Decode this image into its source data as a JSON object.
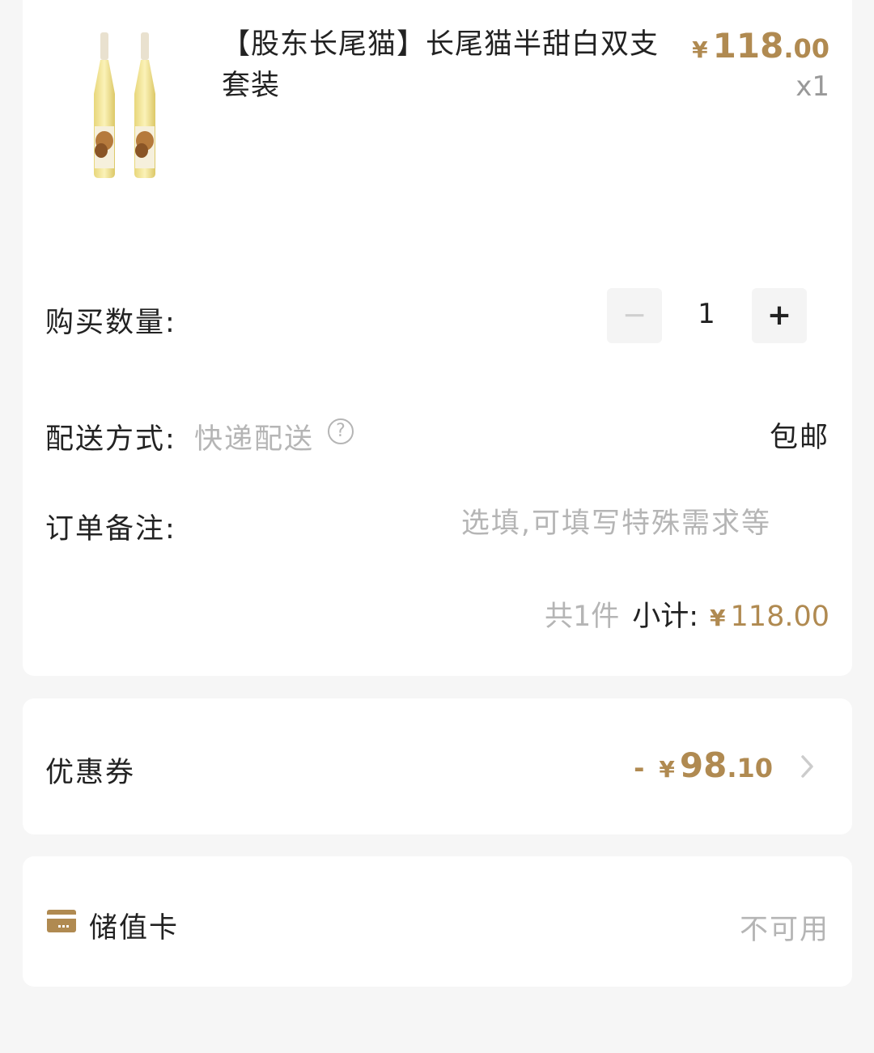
{
  "product": {
    "title": "【股东长尾猫】长尾猫半甜白双支套装",
    "price_symbol": "¥",
    "price_int": "118",
    "price_dec": ".00",
    "quantity_text": "x1"
  },
  "quantity": {
    "label": "购买数量:",
    "minus_label": "−",
    "value": "1",
    "plus_label": "+"
  },
  "shipping": {
    "label": "配送方式:",
    "method": "快递配送",
    "help_glyph": "?",
    "fee": "包邮"
  },
  "remark": {
    "label": "订单备注:",
    "placeholder": "选填,可填写特殊需求等",
    "value": ""
  },
  "subtotal": {
    "count_text": "共1件",
    "label": "小计:",
    "symbol": "¥",
    "amount": "118.00"
  },
  "coupon": {
    "label": "优惠券",
    "minus": "-",
    "symbol": "¥",
    "amount_int": "98",
    "amount_dec": ".10"
  },
  "stored_value_card": {
    "label": "储值卡",
    "status": "不可用"
  },
  "colors": {
    "accent": "#b08a51",
    "muted": "#b5b5b5",
    "text": "#222222",
    "background": "#f6f6f6"
  }
}
